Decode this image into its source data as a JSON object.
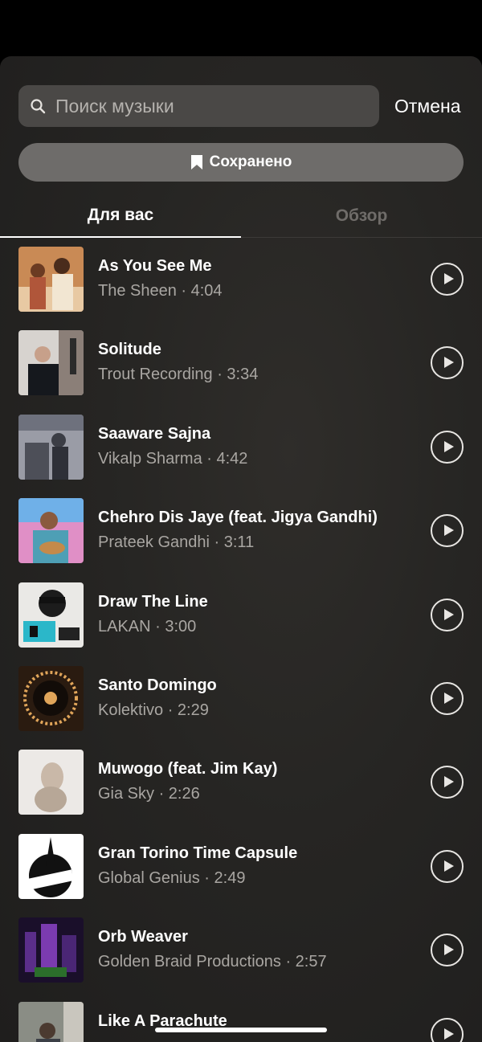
{
  "search": {
    "placeholder": "Поиск музыки",
    "cancel_label": "Отмена"
  },
  "saved": {
    "label": "Сохранено",
    "icon": "bookmark-icon"
  },
  "tabs": [
    {
      "label": "Для вас",
      "active": true
    },
    {
      "label": "Обзор",
      "active": false
    }
  ],
  "tracks": [
    {
      "title": "As You See Me",
      "artist": "The Sheen",
      "duration": "4:04",
      "subtitle": "The Sheen · 4:04"
    },
    {
      "title": "Solitude",
      "artist": "Trout Recording",
      "duration": "3:34",
      "subtitle": "Trout Recording · 3:34"
    },
    {
      "title": "Saaware Sajna",
      "artist": "Vikalp Sharma",
      "duration": "4:42",
      "subtitle": "Vikalp Sharma · 4:42"
    },
    {
      "title": "Chehro Dis Jaye (feat. Jigya Gandhi)",
      "artist": "Prateek Gandhi",
      "duration": "3:11",
      "subtitle": "Prateek Gandhi · 3:11"
    },
    {
      "title": "Draw The Line",
      "artist": "LAKAN",
      "duration": "3:00",
      "subtitle": "LAKAN · 3:00"
    },
    {
      "title": "Santo Domingo",
      "artist": "Kolektivo",
      "duration": "2:29",
      "subtitle": "Kolektivo · 2:29"
    },
    {
      "title": "Muwogo (feat. Jim Kay)",
      "artist": "Gia Sky",
      "duration": "2:26",
      "subtitle": "Gia Sky · 2:26"
    },
    {
      "title": "Gran Torino Time Capsule",
      "artist": "Global Genius",
      "duration": "2:49",
      "subtitle": "Global Genius · 2:49"
    },
    {
      "title": "Orb Weaver",
      "artist": "Golden Braid Productions",
      "duration": "2:57",
      "subtitle": "Golden Braid Productions · 2:57"
    },
    {
      "title": "Like A Parachute",
      "artist": "",
      "duration": "",
      "subtitle": ""
    }
  ],
  "colors": {
    "background": "#262523",
    "search_field": "#4a4846",
    "saved_button": "#6e6c6a",
    "muted_text": "#a9a6a2",
    "inactive_tab": "#6f6c69"
  }
}
